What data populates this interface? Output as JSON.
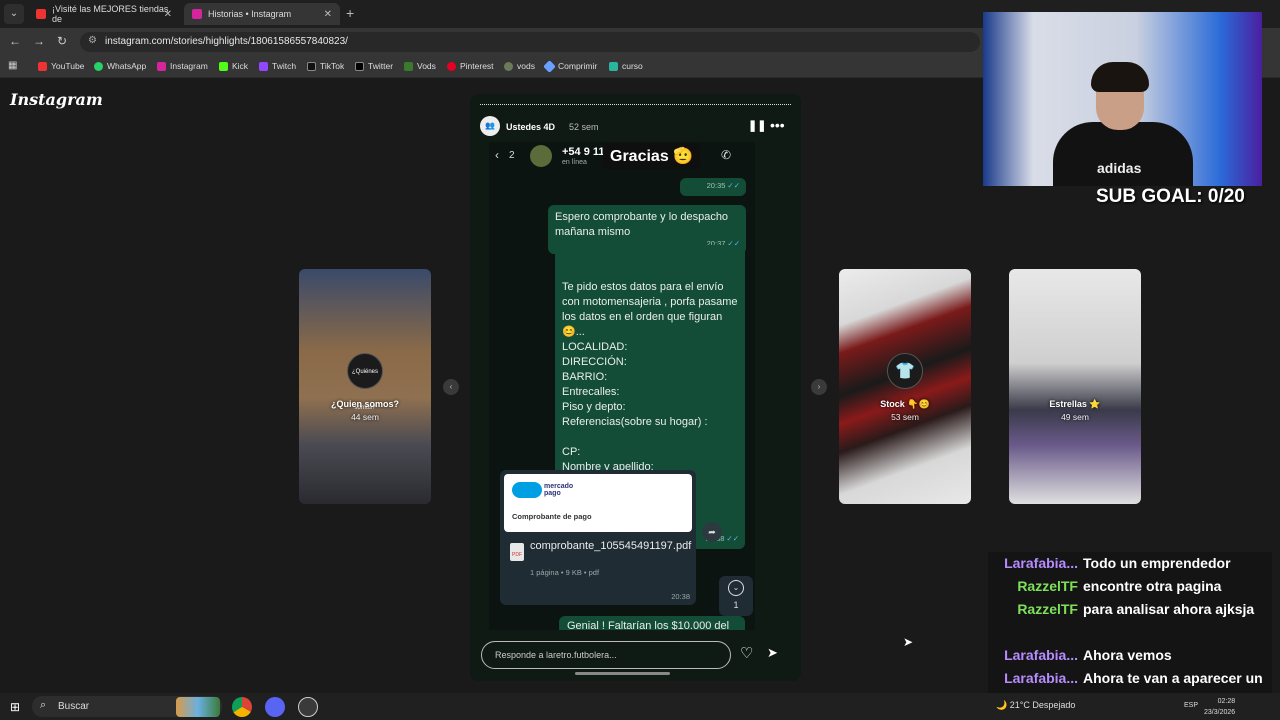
{
  "browser": {
    "tabs": [
      {
        "title": "¡Visité las MEJORES tiendas de",
        "active": false
      },
      {
        "title": "Historias • Instagram",
        "active": true
      }
    ],
    "url": "instagram.com/stories/highlights/18061586557840823/",
    "bookmarks": [
      "YouTube",
      "WhatsApp",
      "Instagram",
      "Kick",
      "Twitch",
      "TikTok",
      "Twitter",
      "Vods",
      "Pinterest",
      "vods",
      "Comprimir",
      "curso"
    ]
  },
  "instagram": {
    "logo": "Instagram",
    "viewer": {
      "username": "Ustedes 4D",
      "time": "52 sem",
      "reply_placeholder": "Responde a laretro.futbolera..."
    },
    "side_stories": [
      {
        "title": "¿Quien somos?",
        "time": "44 sem",
        "circle": "¿Quiénes somos?"
      },
      {
        "title": "Stock 👇😊",
        "time": "53 sem",
        "circle": "👕"
      },
      {
        "title": "Estrellas ⭐",
        "time": "49 sem",
        "circle": ""
      }
    ]
  },
  "whatsapp": {
    "back_count": "2",
    "contact": "+54 9 11",
    "status": "en línea",
    "sticker": "Gracias 🫡",
    "messages": [
      {
        "text": "",
        "time": "20:35"
      },
      {
        "text": "Espero comprobante y lo despacho mañana mismo",
        "time": "20:37"
      },
      {
        "text": "Te pido estos datos para el envío con motomensajeria , porfa pasame los datos en el orden que figuran 😊...\nLOCALIDAD:\nDIRECCIÓN:\nBARRIO:\nEntrecalles:\nPiso y depto:\nReferencias(sobre su hogar) :\n\nCP:\nNombre y apellido:\nTeléfono :",
        "time": "20:38"
      }
    ],
    "payment": {
      "brand": "mercado pago",
      "title": "Comprobante de pago",
      "file": "comprobante_105545491197.pdf",
      "meta": "1 página • 9 KB • pdf",
      "time": "20:38"
    },
    "unread": "1",
    "cut_message": "Genial ! Faltarían los $10.000 del"
  },
  "stream": {
    "sub_goal": "SUB GOAL: 0/20",
    "chat": [
      {
        "nick": "Larafabia...",
        "color": "#b78cff",
        "msg": "Todo un emprendedor"
      },
      {
        "nick": "RazzelTF",
        "color": "#7ee05a",
        "msg": "encontre otra pagina"
      },
      {
        "nick": "RazzelTF",
        "color": "#7ee05a",
        "msg": "para analisar ahora ajksja"
      },
      {
        "nick": "Larafabia...",
        "color": "#b78cff",
        "msg": "Ahora vemos"
      },
      {
        "nick": "Larafabia...",
        "color": "#b78cff",
        "msg": "Ahora te van a aparecer un montón"
      }
    ]
  },
  "taskbar": {
    "search": "Buscar",
    "weather": "21°C  Despejado",
    "lang": "ESP",
    "time": "02:28",
    "date": "23/3/2026"
  },
  "colors": {
    "wa_bubble": "#144d37",
    "nick_purple": "#b78cff",
    "nick_green": "#7ee05a"
  }
}
